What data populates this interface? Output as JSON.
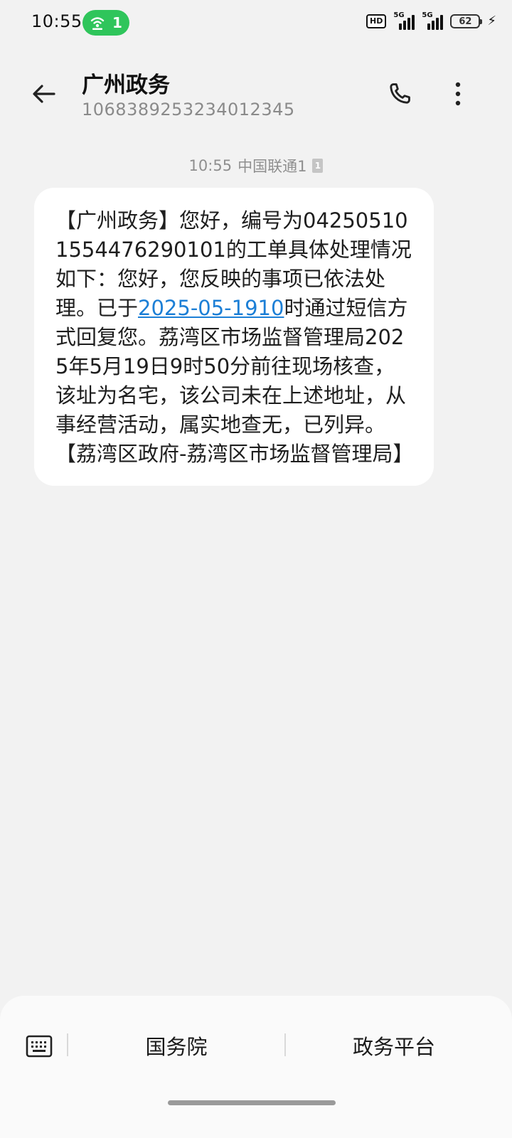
{
  "status_bar": {
    "time": "10:55",
    "hotspot_count": "1",
    "hd_label": "HD",
    "signal1_label": "5G",
    "signal2_label": "5G",
    "battery": "62"
  },
  "header": {
    "contact_name": "广州政务",
    "contact_number": "1068389253234012345"
  },
  "message": {
    "time": "10:55",
    "carrier": "中国联通1",
    "sim_slot": "1",
    "text_before_link": "【广州政务】您好，编号为0425051015544762901​01的工单具体处理情况如下：您好，您反映的事项已依法处理。已于",
    "link_text": "2025-05-1910",
    "text_after_link": "时通过短信方式回复您。荔湾区市场监督管理局2025年5月19日9时50分前往现场核查，该址为名宅，该公司未在上述地址，从事经营活动，属实地查无，已列异。【荔湾区政府-荔湾区市场监督管理局】"
  },
  "bottom_bar": {
    "menu1": "国务院",
    "menu2": "政务平台"
  },
  "colors": {
    "background": "#f2f2f2",
    "bubble": "#ffffff",
    "link": "#1c7fd6",
    "hotspot": "#2fc55b"
  }
}
